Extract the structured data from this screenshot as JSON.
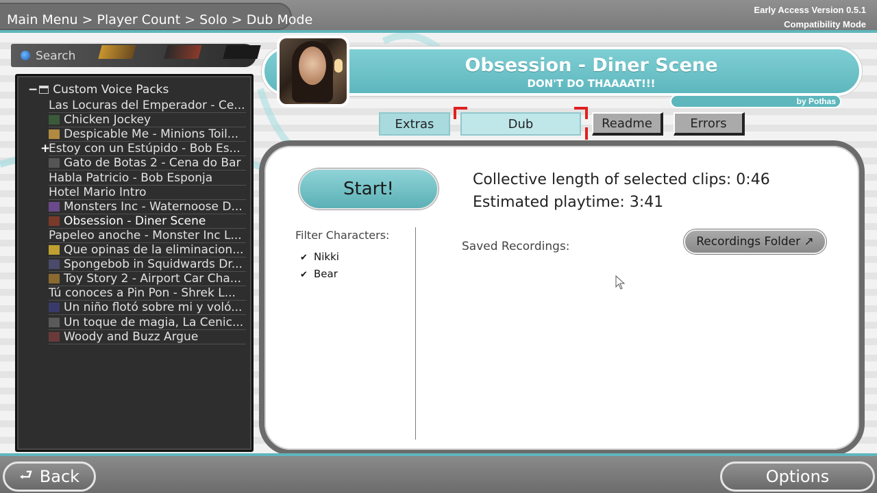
{
  "topbar": {
    "breadcrumb": "Main Menu > Player Count > Solo > Dub Mode",
    "version": "Early Access Version 0.5.1",
    "mode": "Compatibility Mode"
  },
  "search": {
    "label": "Search"
  },
  "tree": {
    "root_label": "Custom Voice Packs",
    "items": [
      {
        "label": "Las Locuras del Emperador - Ce...",
        "thumb": false
      },
      {
        "label": "Chicken Jockey",
        "thumb": true
      },
      {
        "label": "Despicable Me - Minions Toil...",
        "thumb": true
      },
      {
        "label": "Estoy con un Estúpido - Bob Es...",
        "thumb": false,
        "expandable": true
      },
      {
        "label": "Gato de Botas 2 - Cena do Bar",
        "thumb": true
      },
      {
        "label": "Habla Patricio - Bob Esponja",
        "thumb": false
      },
      {
        "label": "Hotel Mario Intro",
        "thumb": false
      },
      {
        "label": "Monsters Inc - Waternoose D...",
        "thumb": true
      },
      {
        "label": "Obsession - Diner Scene",
        "thumb": true,
        "selected": true
      },
      {
        "label": "Papeleo anoche - Monster Inc L...",
        "thumb": false
      },
      {
        "label": "Que opinas de la eliminacion...",
        "thumb": true
      },
      {
        "label": "Spongebob in Squidwards Dr...",
        "thumb": true
      },
      {
        "label": "Toy Story 2 - Airport Car Cha...",
        "thumb": true
      },
      {
        "label": "Tú conoces a Pin Pon - Shrek L...",
        "thumb": false
      },
      {
        "label": "Un niño flotó sobre mi y voló...",
        "thumb": true
      },
      {
        "label": "Un toque de magia, La Cenic...",
        "thumb": true
      },
      {
        "label": "Woody and Buzz Argue",
        "thumb": true
      }
    ]
  },
  "header": {
    "title": "Obsession - Diner Scene",
    "subtitle": "DON'T DO THAAAAT!!!",
    "author": "by Pothas"
  },
  "tabs": {
    "extras": "Extras",
    "dub": "Dub",
    "readme": "Readme",
    "errors": "Errors",
    "active": "Dub"
  },
  "main": {
    "start_label": "Start!",
    "clip_length": "Collective length of selected clips:  0:46",
    "playtime": "Estimated playtime:  3:41",
    "filter_title": "Filter Characters:",
    "characters": [
      {
        "name": "Nikki",
        "checked": true
      },
      {
        "name": "Bear",
        "checked": true
      }
    ],
    "saved_label": "Saved Recordings:",
    "recordings_folder": "Recordings Folder ↗"
  },
  "bottom": {
    "back": "Back",
    "options": "Options"
  },
  "colors": {
    "accent": "#5db7bd",
    "selection": "#e02020"
  }
}
